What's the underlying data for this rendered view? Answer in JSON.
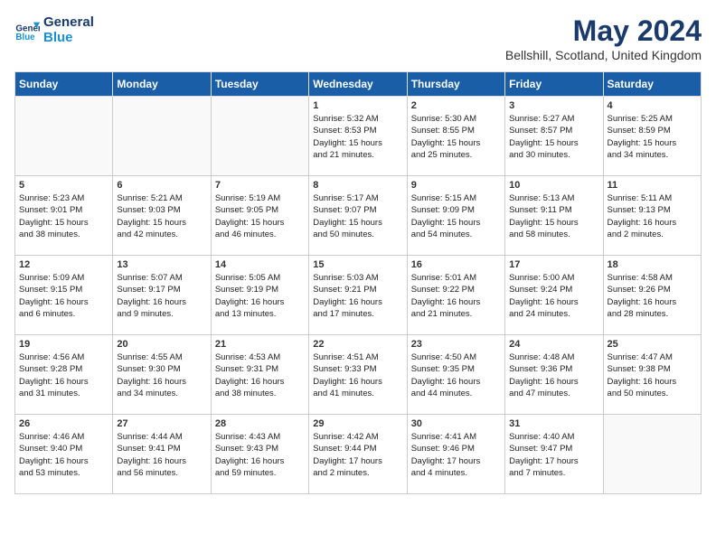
{
  "logo": {
    "line1": "General",
    "line2": "Blue"
  },
  "title": "May 2024",
  "location": "Bellshill, Scotland, United Kingdom",
  "headers": [
    "Sunday",
    "Monday",
    "Tuesday",
    "Wednesday",
    "Thursday",
    "Friday",
    "Saturday"
  ],
  "weeks": [
    [
      {
        "day": "",
        "info": "",
        "empty": true
      },
      {
        "day": "",
        "info": "",
        "empty": true
      },
      {
        "day": "",
        "info": "",
        "empty": true
      },
      {
        "day": "1",
        "info": "Sunrise: 5:32 AM\nSunset: 8:53 PM\nDaylight: 15 hours\nand 21 minutes."
      },
      {
        "day": "2",
        "info": "Sunrise: 5:30 AM\nSunset: 8:55 PM\nDaylight: 15 hours\nand 25 minutes."
      },
      {
        "day": "3",
        "info": "Sunrise: 5:27 AM\nSunset: 8:57 PM\nDaylight: 15 hours\nand 30 minutes."
      },
      {
        "day": "4",
        "info": "Sunrise: 5:25 AM\nSunset: 8:59 PM\nDaylight: 15 hours\nand 34 minutes."
      }
    ],
    [
      {
        "day": "5",
        "info": "Sunrise: 5:23 AM\nSunset: 9:01 PM\nDaylight: 15 hours\nand 38 minutes."
      },
      {
        "day": "6",
        "info": "Sunrise: 5:21 AM\nSunset: 9:03 PM\nDaylight: 15 hours\nand 42 minutes."
      },
      {
        "day": "7",
        "info": "Sunrise: 5:19 AM\nSunset: 9:05 PM\nDaylight: 15 hours\nand 46 minutes."
      },
      {
        "day": "8",
        "info": "Sunrise: 5:17 AM\nSunset: 9:07 PM\nDaylight: 15 hours\nand 50 minutes."
      },
      {
        "day": "9",
        "info": "Sunrise: 5:15 AM\nSunset: 9:09 PM\nDaylight: 15 hours\nand 54 minutes."
      },
      {
        "day": "10",
        "info": "Sunrise: 5:13 AM\nSunset: 9:11 PM\nDaylight: 15 hours\nand 58 minutes."
      },
      {
        "day": "11",
        "info": "Sunrise: 5:11 AM\nSunset: 9:13 PM\nDaylight: 16 hours\nand 2 minutes."
      }
    ],
    [
      {
        "day": "12",
        "info": "Sunrise: 5:09 AM\nSunset: 9:15 PM\nDaylight: 16 hours\nand 6 minutes."
      },
      {
        "day": "13",
        "info": "Sunrise: 5:07 AM\nSunset: 9:17 PM\nDaylight: 16 hours\nand 9 minutes."
      },
      {
        "day": "14",
        "info": "Sunrise: 5:05 AM\nSunset: 9:19 PM\nDaylight: 16 hours\nand 13 minutes."
      },
      {
        "day": "15",
        "info": "Sunrise: 5:03 AM\nSunset: 9:21 PM\nDaylight: 16 hours\nand 17 minutes."
      },
      {
        "day": "16",
        "info": "Sunrise: 5:01 AM\nSunset: 9:22 PM\nDaylight: 16 hours\nand 21 minutes."
      },
      {
        "day": "17",
        "info": "Sunrise: 5:00 AM\nSunset: 9:24 PM\nDaylight: 16 hours\nand 24 minutes."
      },
      {
        "day": "18",
        "info": "Sunrise: 4:58 AM\nSunset: 9:26 PM\nDaylight: 16 hours\nand 28 minutes."
      }
    ],
    [
      {
        "day": "19",
        "info": "Sunrise: 4:56 AM\nSunset: 9:28 PM\nDaylight: 16 hours\nand 31 minutes."
      },
      {
        "day": "20",
        "info": "Sunrise: 4:55 AM\nSunset: 9:30 PM\nDaylight: 16 hours\nand 34 minutes."
      },
      {
        "day": "21",
        "info": "Sunrise: 4:53 AM\nSunset: 9:31 PM\nDaylight: 16 hours\nand 38 minutes."
      },
      {
        "day": "22",
        "info": "Sunrise: 4:51 AM\nSunset: 9:33 PM\nDaylight: 16 hours\nand 41 minutes."
      },
      {
        "day": "23",
        "info": "Sunrise: 4:50 AM\nSunset: 9:35 PM\nDaylight: 16 hours\nand 44 minutes."
      },
      {
        "day": "24",
        "info": "Sunrise: 4:48 AM\nSunset: 9:36 PM\nDaylight: 16 hours\nand 47 minutes."
      },
      {
        "day": "25",
        "info": "Sunrise: 4:47 AM\nSunset: 9:38 PM\nDaylight: 16 hours\nand 50 minutes."
      }
    ],
    [
      {
        "day": "26",
        "info": "Sunrise: 4:46 AM\nSunset: 9:40 PM\nDaylight: 16 hours\nand 53 minutes."
      },
      {
        "day": "27",
        "info": "Sunrise: 4:44 AM\nSunset: 9:41 PM\nDaylight: 16 hours\nand 56 minutes."
      },
      {
        "day": "28",
        "info": "Sunrise: 4:43 AM\nSunset: 9:43 PM\nDaylight: 16 hours\nand 59 minutes."
      },
      {
        "day": "29",
        "info": "Sunrise: 4:42 AM\nSunset: 9:44 PM\nDaylight: 17 hours\nand 2 minutes."
      },
      {
        "day": "30",
        "info": "Sunrise: 4:41 AM\nSunset: 9:46 PM\nDaylight: 17 hours\nand 4 minutes."
      },
      {
        "day": "31",
        "info": "Sunrise: 4:40 AM\nSunset: 9:47 PM\nDaylight: 17 hours\nand 7 minutes."
      },
      {
        "day": "",
        "info": "",
        "empty": true
      }
    ]
  ]
}
